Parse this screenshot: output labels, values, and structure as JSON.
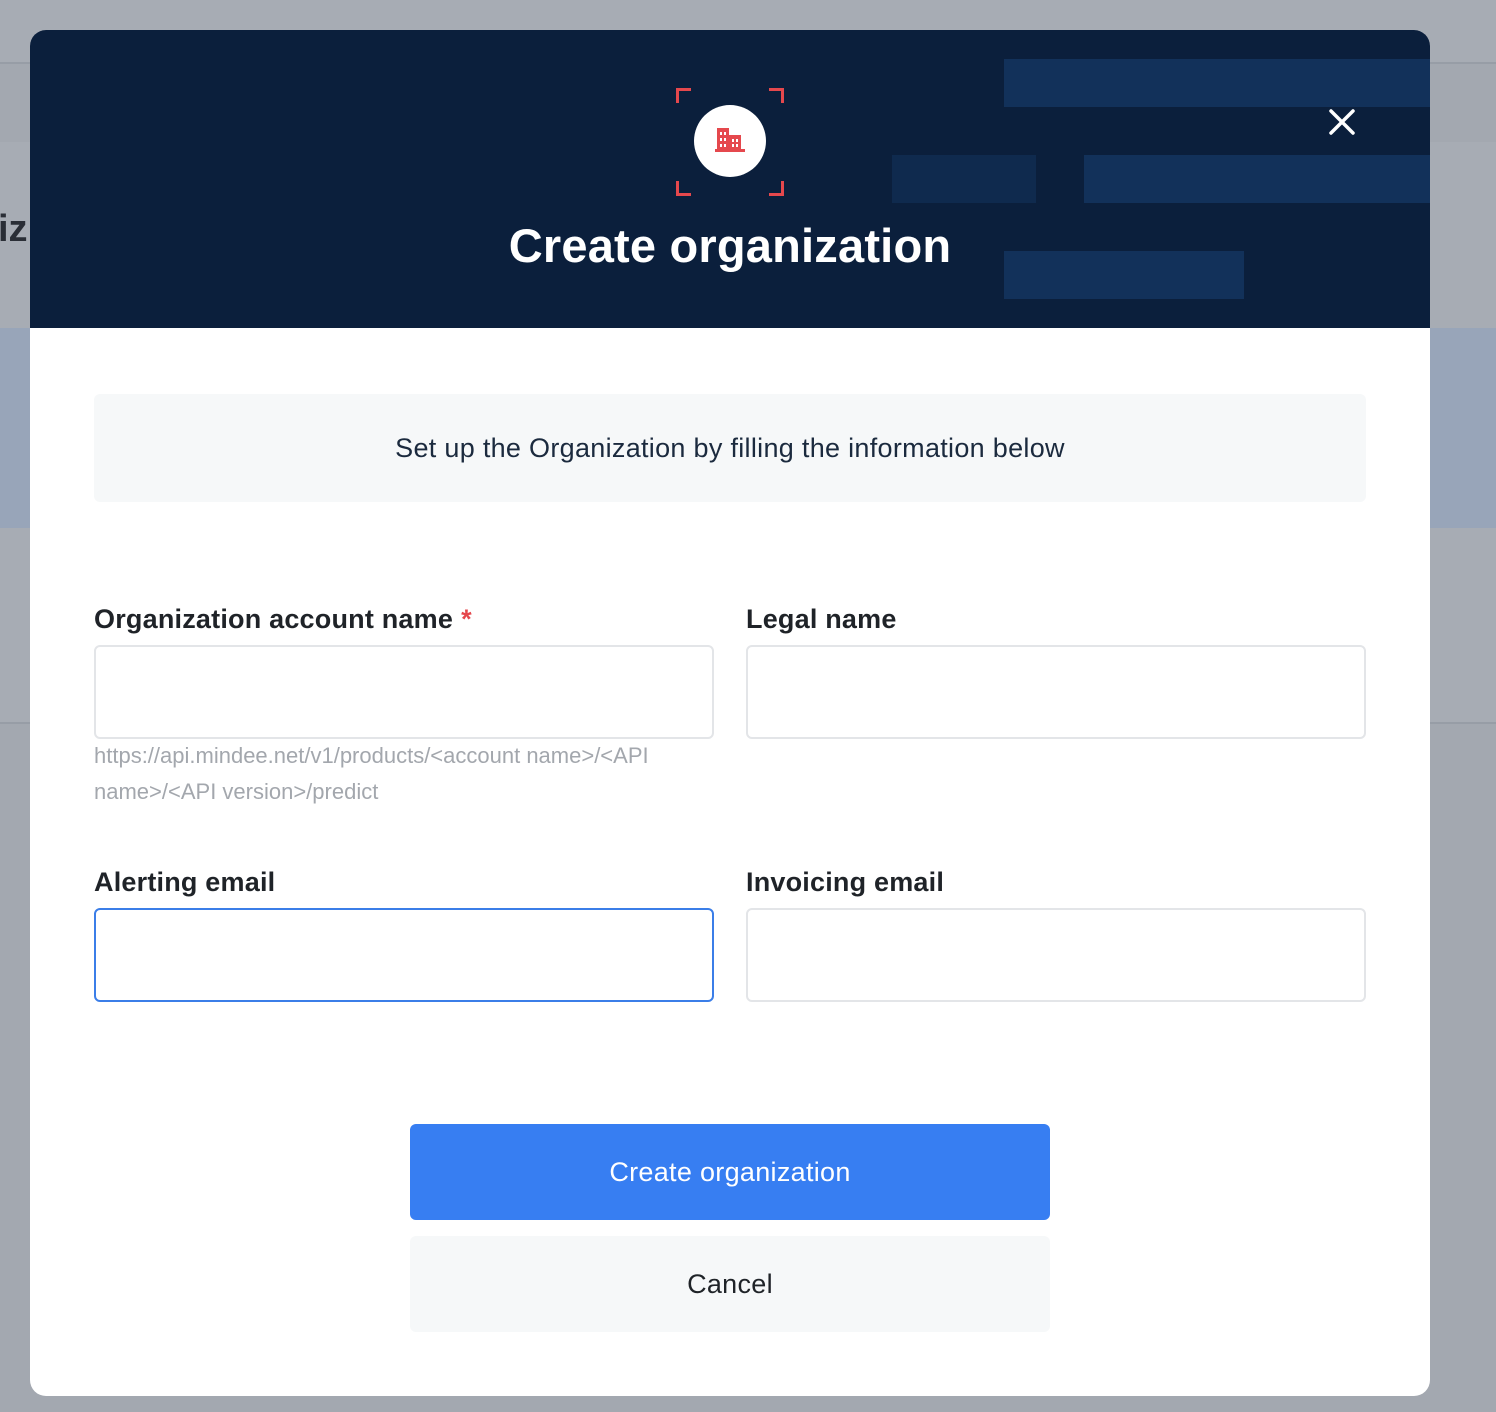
{
  "background": {
    "partial_heading": "iz"
  },
  "modal": {
    "title": "Create organization",
    "logo_icon": "building-icon",
    "close_icon": "close-icon",
    "info_text": "Set up the Organization by filling the information below",
    "fields": {
      "account_name": {
        "label": "Organization account name",
        "required_marker": "*",
        "value": "",
        "hint": "https://api.mindee.net/v1/products/<account name>/<API name>/<API version>/predict"
      },
      "legal_name": {
        "label": "Legal name",
        "value": ""
      },
      "alerting_email": {
        "label": "Alerting email",
        "value": ""
      },
      "invoicing_email": {
        "label": "Invoicing email",
        "value": ""
      }
    },
    "primary_button": "Create organization",
    "secondary_button": "Cancel"
  },
  "colors": {
    "header_bg": "#0b1f3c",
    "accent_red": "#e5484d",
    "primary_blue": "#377ef2",
    "focus_blue": "#3b7ee8"
  }
}
